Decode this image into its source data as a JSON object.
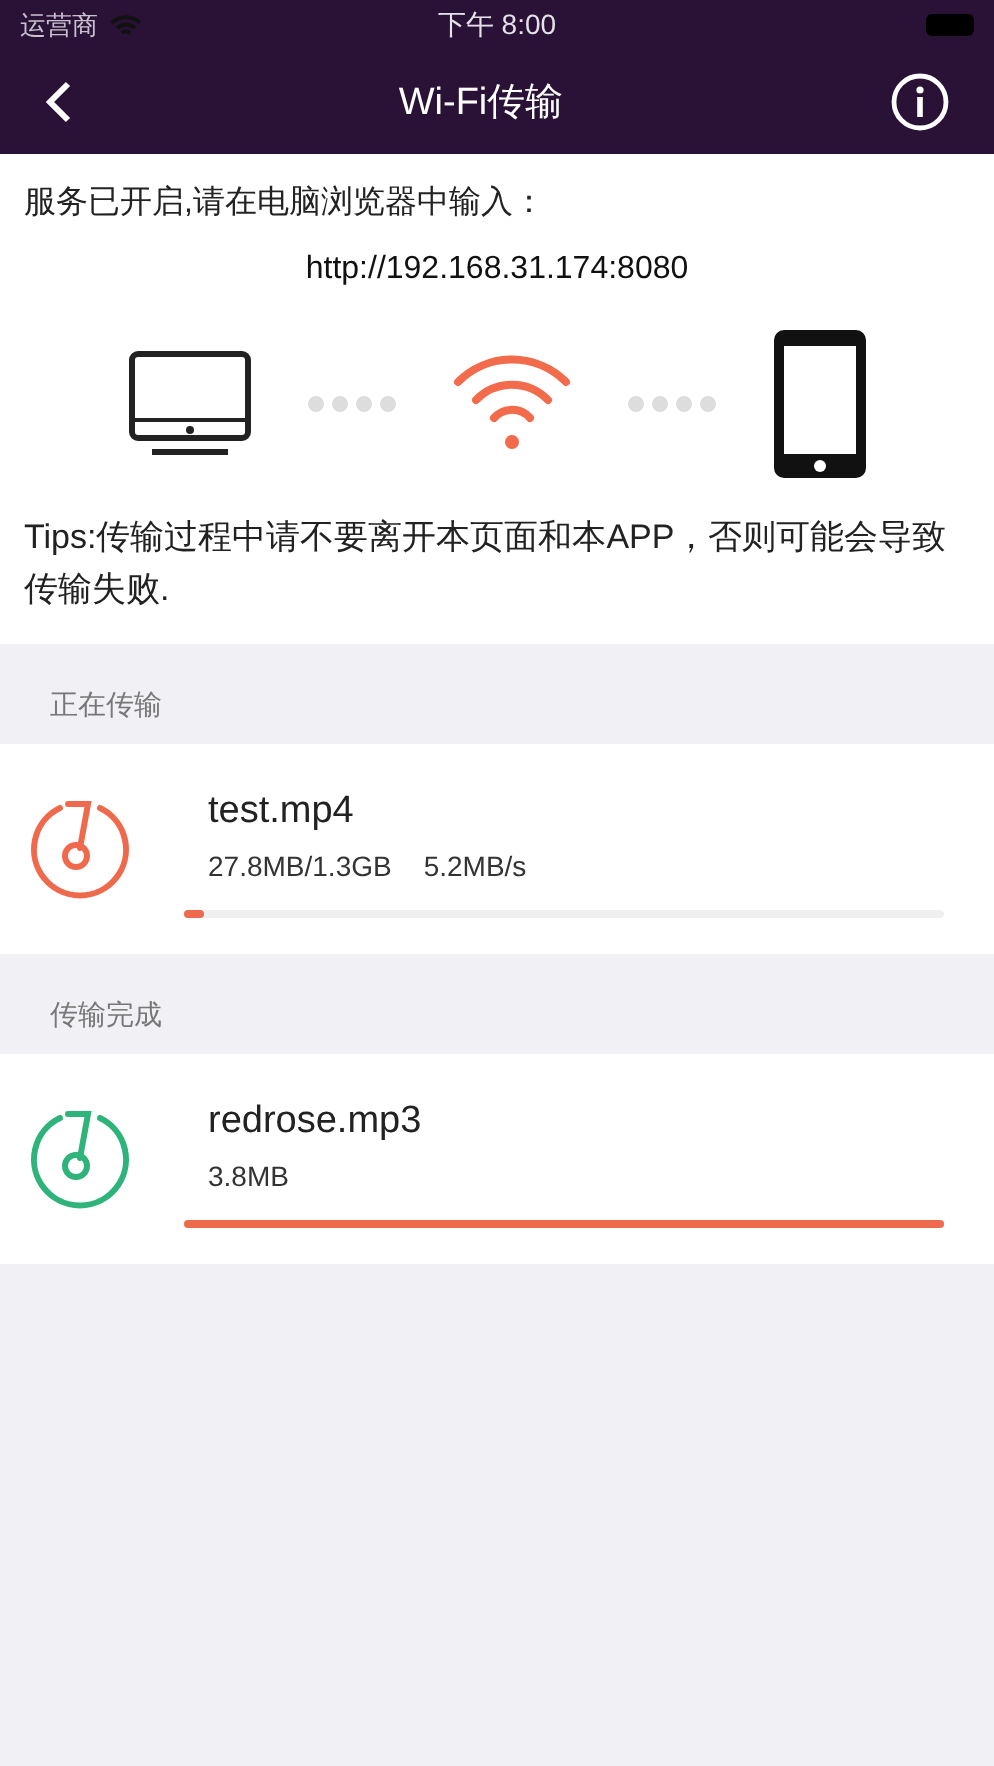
{
  "status_bar": {
    "carrier": "运营商",
    "time": "下午 8:00"
  },
  "nav": {
    "title": "Wi-Fi传输"
  },
  "info": {
    "instruction": "服务已开启,请在电脑浏览器中输入：",
    "url": "http://192.168.31.174:8080",
    "tips": "Tips:传输过程中请不要离开本页面和本APP，否则可能会导致传输失败."
  },
  "sections": [
    {
      "title": "正在传输",
      "items": [
        {
          "name": "test.mp4",
          "detail": "27.8MB/1.3GB",
          "speed": "5.2MB/s",
          "level": 0.02,
          "color": "#ef6a4c"
        }
      ]
    },
    {
      "title": "传输完成",
      "items": [
        {
          "name": "redrose.mp3",
          "detail": "3.8MB",
          "level": 1,
          "color": "#2eb37a"
        }
      ]
    }
  ]
}
